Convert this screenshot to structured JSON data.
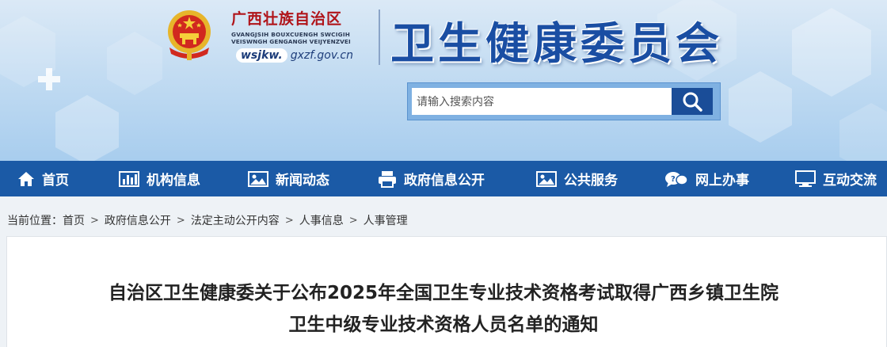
{
  "header": {
    "region_cn": "广西壮族自治区",
    "region_zhuang_line1": "GVANGJSIH BOUXCUENGH SWCIGIH",
    "region_zhuang_line2": "VEISWNGH GENGANGH VEIJYENZVEI",
    "domain_prefix": "wsjkw.",
    "domain_suffix": "gxzf.gov.cn",
    "dept_title": "卫生健康委员会",
    "emblem_icon": "national-emblem-icon"
  },
  "search": {
    "placeholder": "请输入搜索内容",
    "value": "",
    "button_icon": "search-icon"
  },
  "nav": {
    "items": [
      {
        "label": "首页",
        "icon": "home-icon"
      },
      {
        "label": "机构信息",
        "icon": "bar-chart-icon"
      },
      {
        "label": "新闻动态",
        "icon": "image-icon"
      },
      {
        "label": "政府信息公开",
        "icon": "printer-icon"
      },
      {
        "label": "公共服务",
        "icon": "image-icon"
      },
      {
        "label": "网上办事",
        "icon": "chat-bubbles-icon"
      },
      {
        "label": "互动交流",
        "icon": "monitor-icon"
      }
    ]
  },
  "breadcrumb": {
    "prefix": "当前位置：",
    "items": [
      "首页",
      "政府信息公开",
      "法定主动公开内容",
      "人事信息",
      "人事管理"
    ],
    "separator": ">"
  },
  "article": {
    "title_line1": "自治区卫生健康委关于公布2025年全国卫生专业技术资格考试取得广西乡镇卫生院",
    "title_line2": "卫生中级专业技术资格人员名单的通知"
  },
  "colors": {
    "nav_bg": "#1b5aa6",
    "title_blue": "#1a4ea3",
    "region_red": "#b0141a",
    "search_btn": "#1a4d98"
  }
}
